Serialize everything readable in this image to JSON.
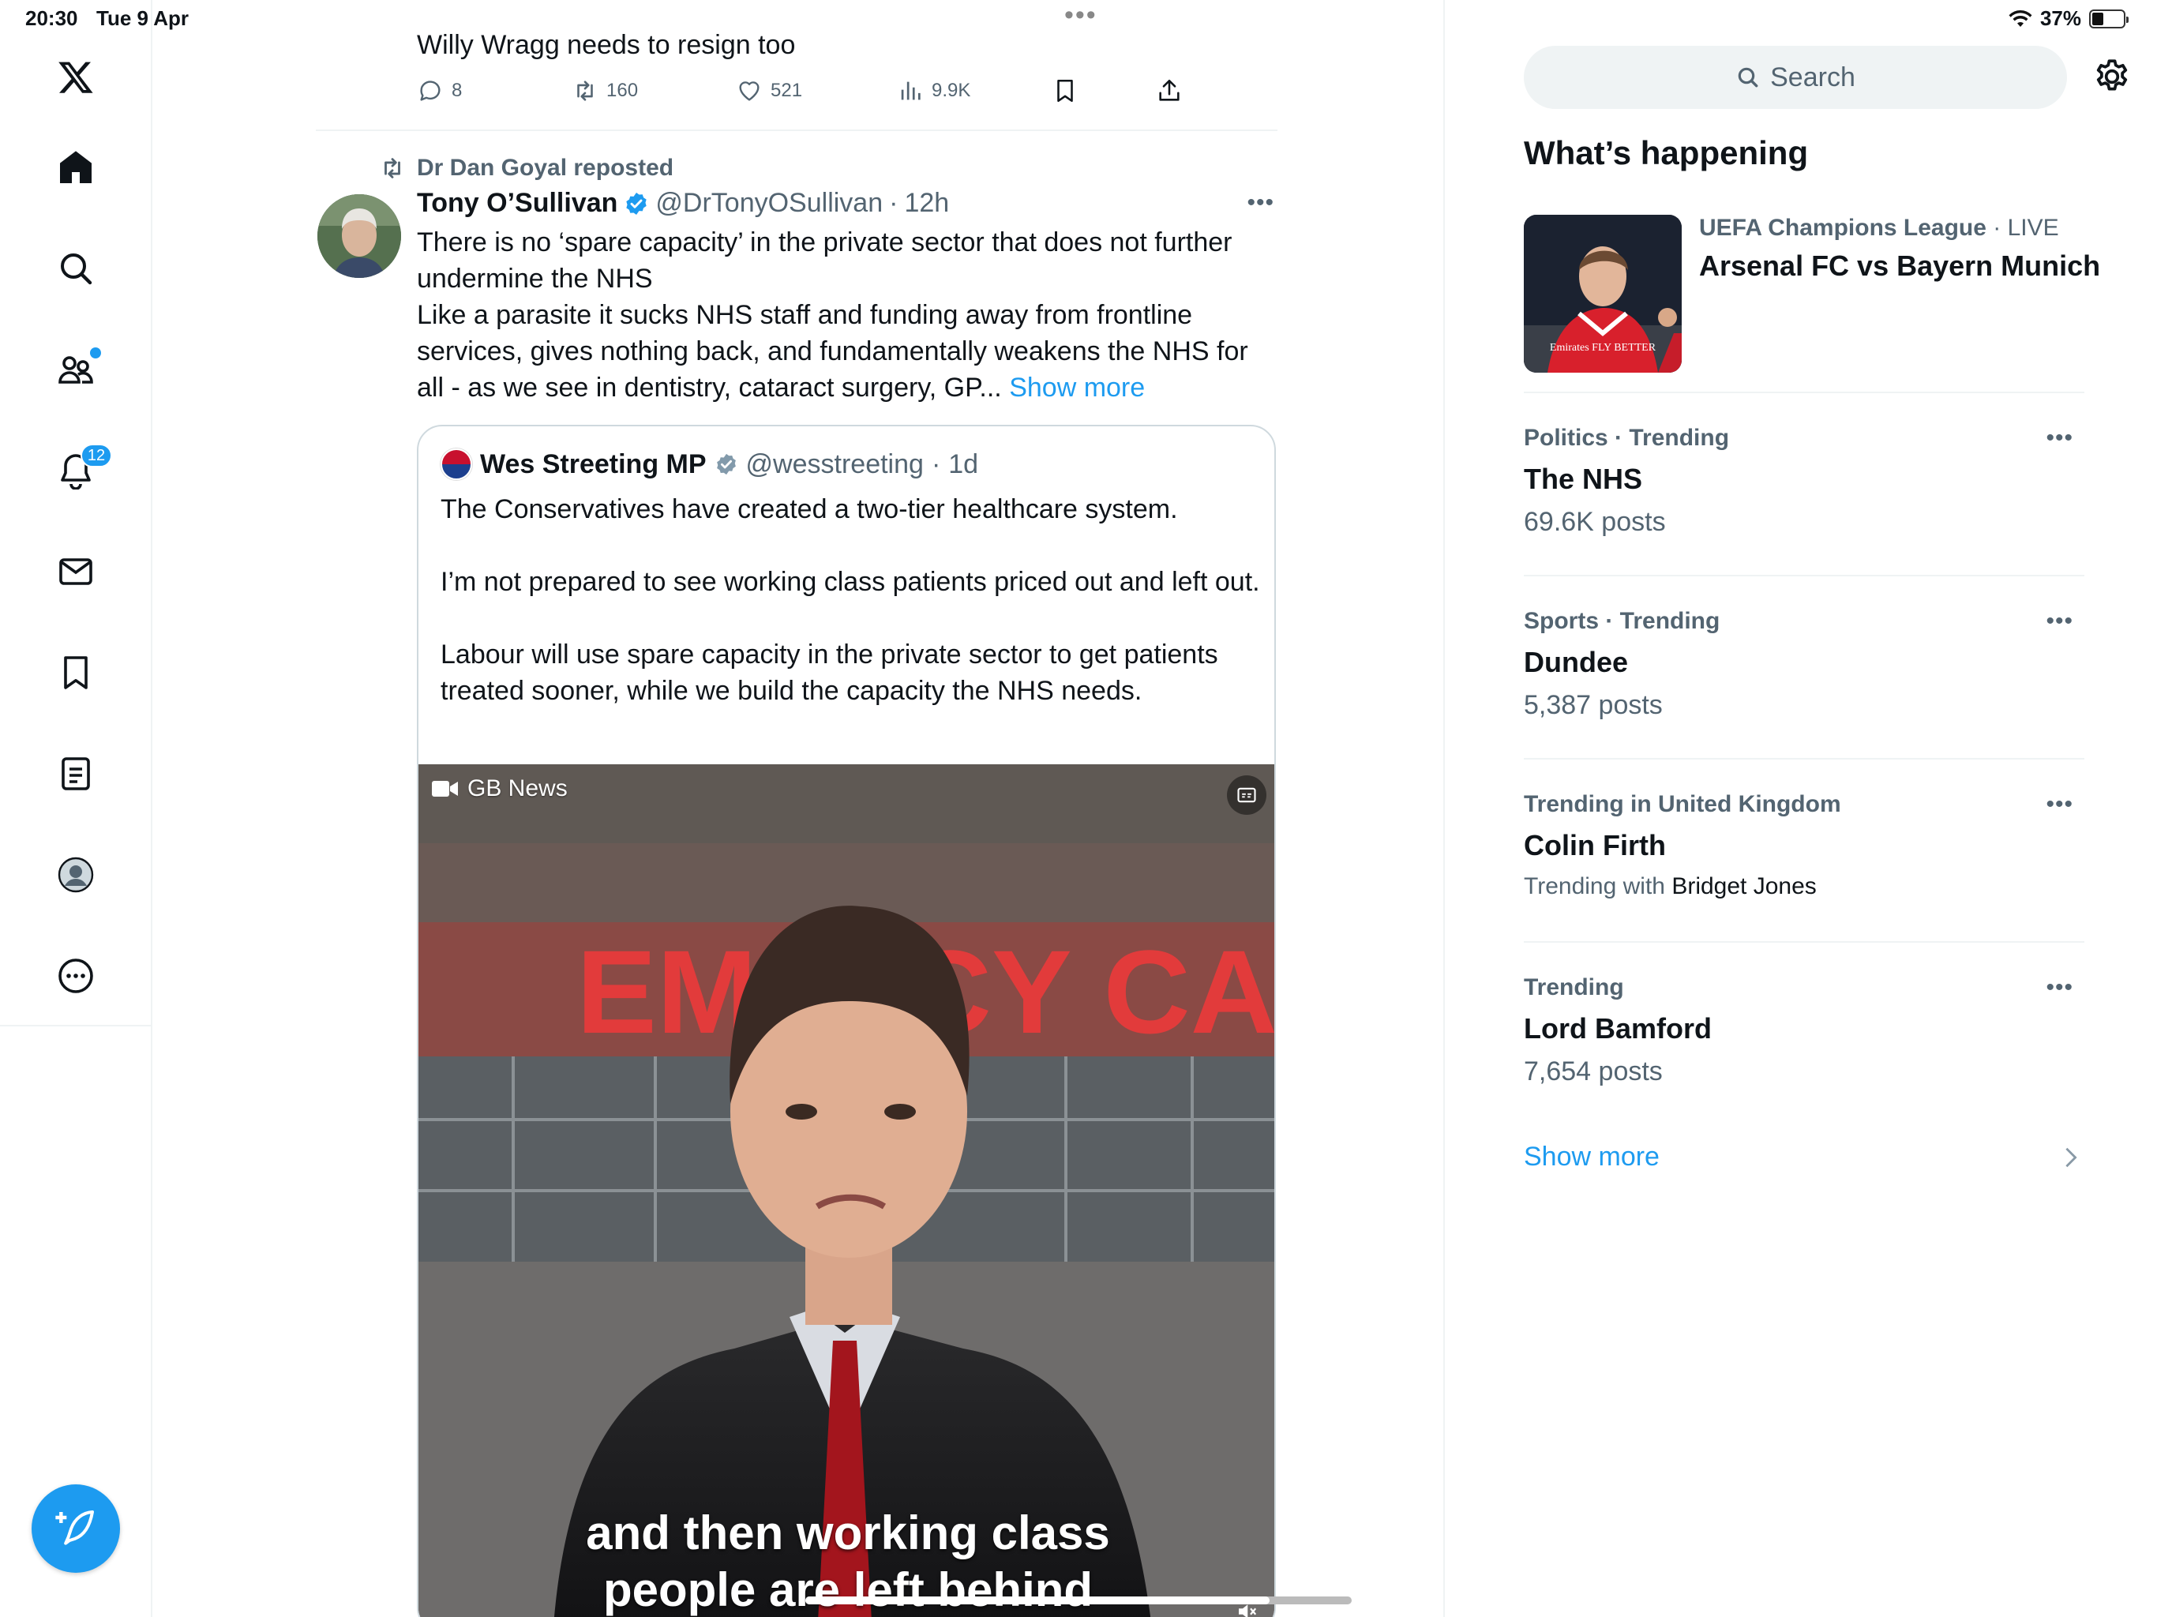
{
  "status_bar": {
    "time": "20:30",
    "date": "Tue 9 Apr",
    "battery": "37%"
  },
  "nav": {
    "community_badge": "",
    "notifications_badge": "12"
  },
  "feed": {
    "prev_tweet": {
      "text": "Willy Wragg needs to resign too",
      "replies": "8",
      "reposts": "160",
      "likes": "521",
      "views": "9.9K"
    },
    "tweet": {
      "reposted_by": "Dr Dan Goyal reposted",
      "author_name": "Tony O’Sullivan",
      "handle": "@DrTonyOSullivan",
      "sep": "·",
      "time": "12h",
      "body_line1": "There is no ‘spare capacity’ in the private sector that does not further undermine the NHS",
      "body_line2": "Like a parasite it sucks NHS staff and funding away from frontline services, gives nothing back, and fundamentally weakens the NHS for all - as we see in dentistry, cataract surgery, GP...",
      "show_more": "Show more",
      "quote": {
        "author_name": "Wes Streeting MP",
        "handle": "@wesstreeting",
        "sep": "·",
        "time": "1d",
        "p1": "The Conservatives have created a two-tier healthcare system.",
        "p2": "I’m not prepared to see working class patients priced out and left out.",
        "p3": "Labour will use spare capacity in the private sector to get patients treated sooner, while we build the capacity the NHS needs.",
        "video": {
          "source_label": "GB News",
          "sign_text": "EME      ICY    CA",
          "caption_line1": "and then working class",
          "caption_line2": "people are left behind",
          "progress": 0.85
        }
      }
    }
  },
  "sidebar": {
    "search_placeholder": "Search",
    "title": "What’s happening",
    "hero": {
      "category": "UEFA Champions League",
      "status": "· LIVE",
      "title": "Arsenal FC vs Bayern Munich",
      "shirt_text": "Emirates FLY BETTER"
    },
    "trends": [
      {
        "category": "Politics · Trending",
        "name": "The NHS",
        "count": "69.6K posts"
      },
      {
        "category": "Sports · Trending",
        "name": "Dundee",
        "count": "5,387 posts"
      },
      {
        "category": "Trending in United Kingdom",
        "name": "Colin Firth",
        "with_prefix": "Trending with",
        "with_name": "Bridget Jones"
      },
      {
        "category": "Trending",
        "name": "Lord Bamford",
        "count": "7,654 posts"
      }
    ],
    "show_more": "Show more"
  },
  "colors": {
    "accent": "#1d9bf0",
    "muted": "#536471",
    "text": "#0f1419",
    "border": "#eff3f4"
  }
}
